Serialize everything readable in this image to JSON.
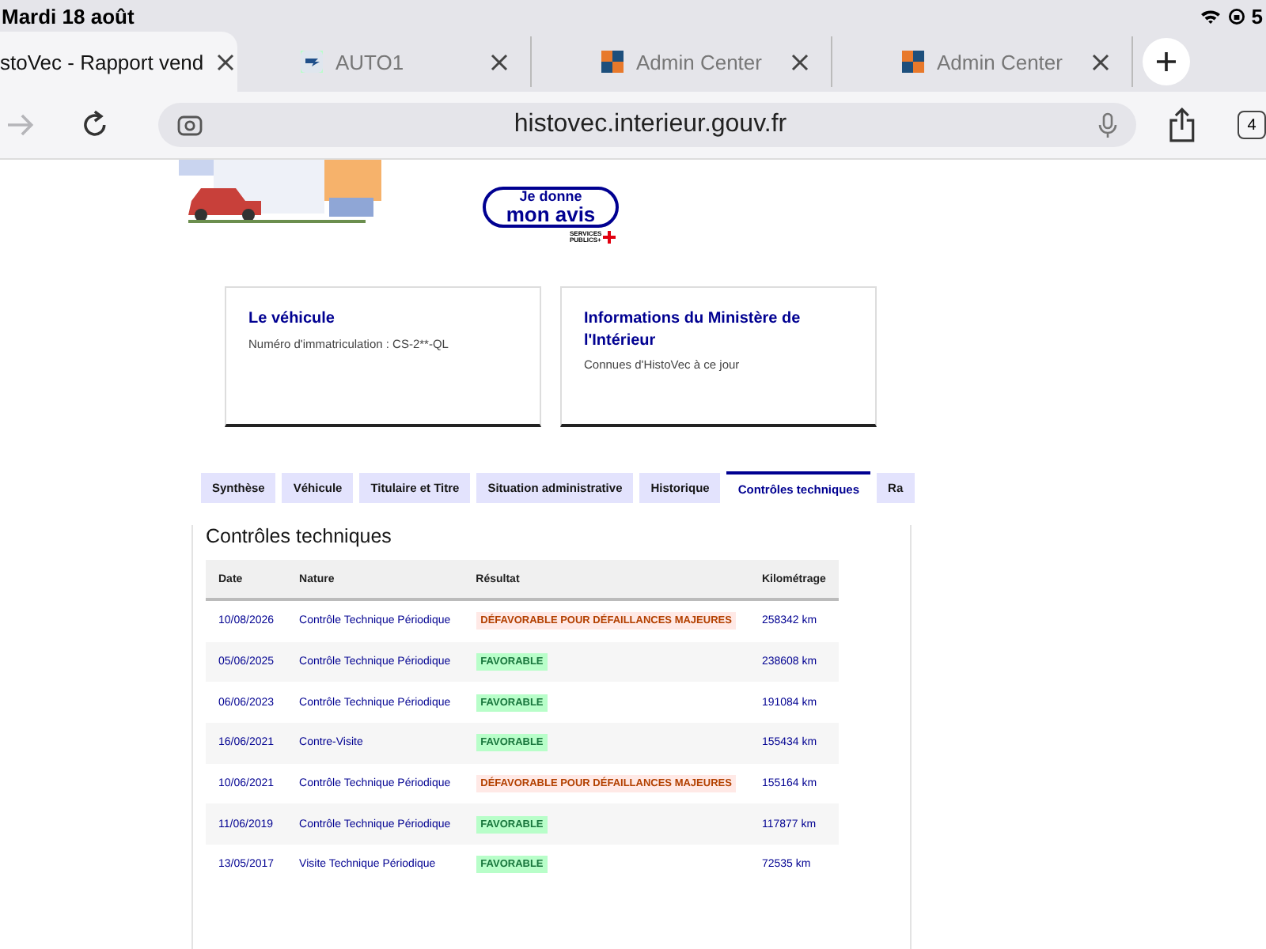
{
  "status_bar": {
    "date": "Mardi 18 août",
    "battery": "5"
  },
  "browser_tabs": [
    {
      "title": "stoVec - Rapport vend",
      "selected": true,
      "kind": "plain"
    },
    {
      "title": "AUTO1",
      "selected": false,
      "kind": "car"
    },
    {
      "title": "Admin Center",
      "selected": false,
      "kind": "squares"
    },
    {
      "title": "Admin Center",
      "selected": false,
      "kind": "squares"
    }
  ],
  "toolbar": {
    "forward_disabled": true,
    "url": "histovec.interieur.gouv.fr",
    "tab_count": "4"
  },
  "feedback_badge": {
    "line1": "Je donne",
    "line2": "mon avis",
    "brand": "SERVICES PUBLICS+"
  },
  "cards": [
    {
      "title": "Le véhicule",
      "text": "Numéro d'immatriculation : CS-2**-QL"
    },
    {
      "title": "Informations du Ministère de l'Intérieur",
      "text": "Connues d'HistoVec à ce jour"
    }
  ],
  "tabs": [
    {
      "label": "Synthèse",
      "selected": false
    },
    {
      "label": "Véhicule",
      "selected": false
    },
    {
      "label": "Titulaire et Titre",
      "selected": false
    },
    {
      "label": "Situation administrative",
      "selected": false
    },
    {
      "label": "Historique",
      "selected": false
    },
    {
      "label": "Contrôles techniques",
      "selected": true
    },
    {
      "label": "Ra",
      "selected": false
    }
  ],
  "section_title": "Contrôles techniques",
  "table": {
    "columns": [
      "Date",
      "Nature",
      "Résultat",
      "Kilométrage"
    ],
    "rows": [
      {
        "date": "10/08/2026",
        "nature": "Contrôle Technique Périodique",
        "result": "DÉFAVORABLE POUR DÉFAILLANCES MAJEURES",
        "kind": "unfavorable",
        "km": "258342 km"
      },
      {
        "date": "05/06/2025",
        "nature": "Contrôle Technique Périodique",
        "result": "FAVORABLE",
        "kind": "favorable",
        "km": "238608 km"
      },
      {
        "date": "06/06/2023",
        "nature": "Contrôle Technique Périodique",
        "result": "FAVORABLE",
        "kind": "favorable",
        "km": "191084 km"
      },
      {
        "date": "16/06/2021",
        "nature": "Contre-Visite",
        "result": "FAVORABLE",
        "kind": "favorable",
        "km": "155434 km"
      },
      {
        "date": "10/06/2021",
        "nature": "Contrôle Technique Périodique",
        "result": "DÉFAVORABLE POUR DÉFAILLANCES MAJEURES",
        "kind": "unfavorable",
        "km": "155164 km"
      },
      {
        "date": "11/06/2019",
        "nature": "Contrôle Technique Périodique",
        "result": "FAVORABLE",
        "kind": "favorable",
        "km": "117877 km"
      },
      {
        "date": "13/05/2017",
        "nature": "Visite Technique Périodique",
        "result": "FAVORABLE",
        "kind": "favorable",
        "km": "72535 km"
      }
    ]
  }
}
